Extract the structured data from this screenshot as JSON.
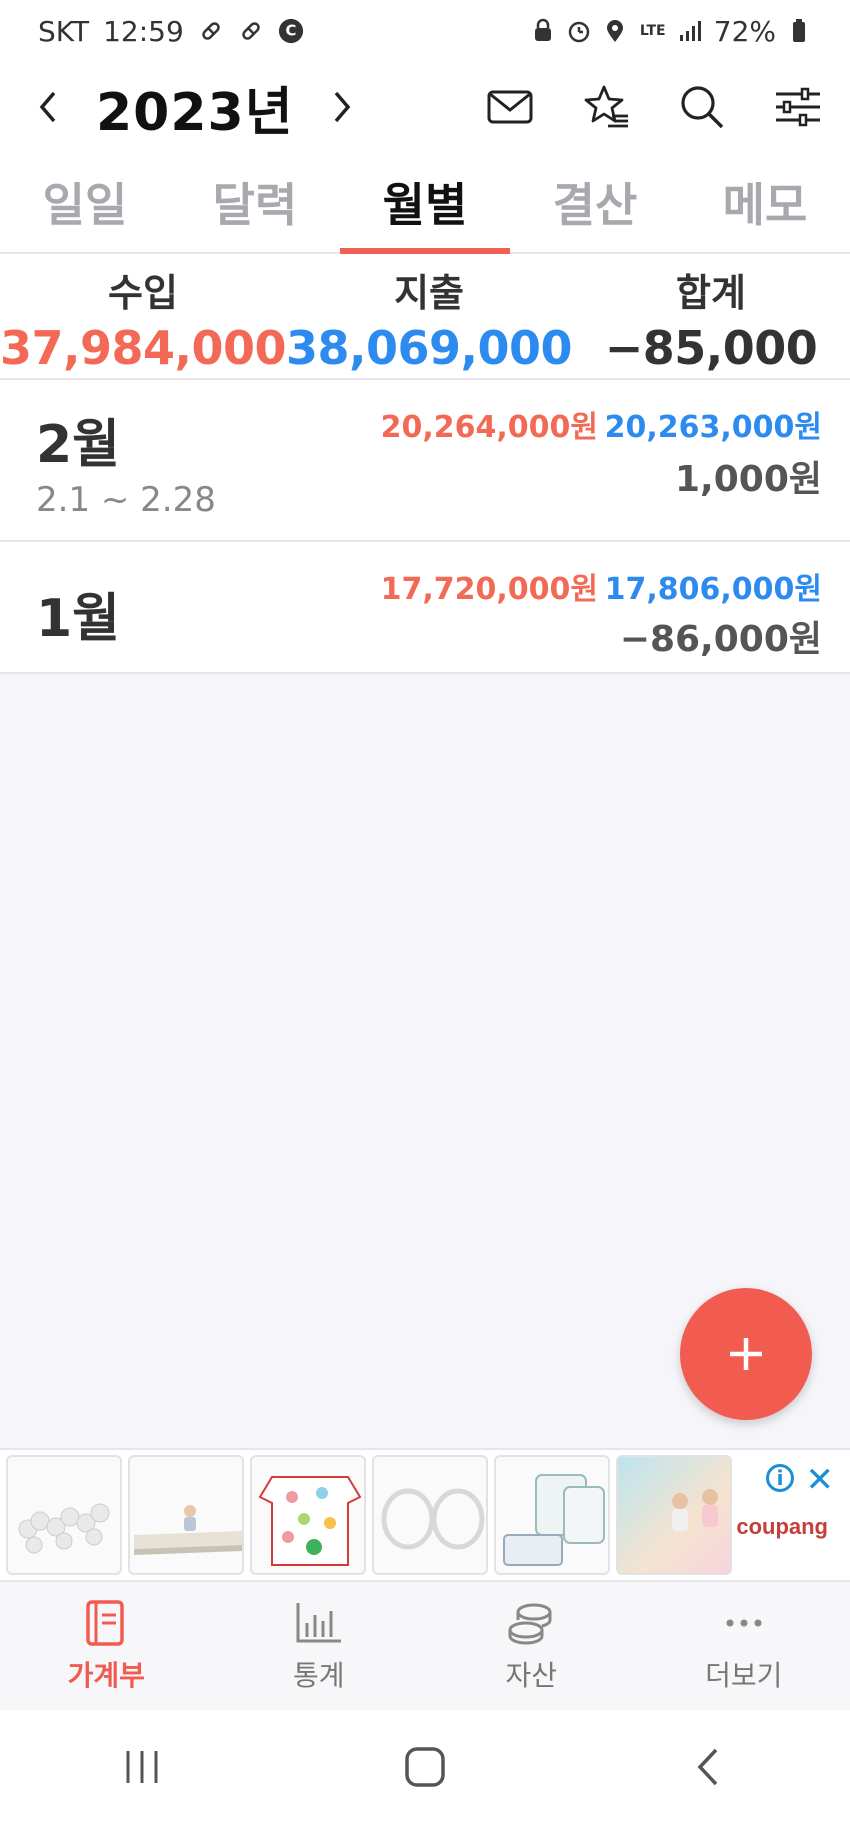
{
  "status_bar": {
    "carrier": "SKT",
    "time": "12:59",
    "battery": "72%",
    "network": "LTE"
  },
  "header": {
    "year": "2023년"
  },
  "tabs": [
    {
      "label": "일일"
    },
    {
      "label": "달력"
    },
    {
      "label": "월별"
    },
    {
      "label": "결산"
    },
    {
      "label": "메모"
    }
  ],
  "summary": {
    "income_label": "수입",
    "income_value": "37,984,000",
    "expense_label": "지출",
    "expense_value": "38,069,000",
    "total_label": "합계",
    "total_value": "−85,000"
  },
  "months": [
    {
      "name": "2월",
      "range": "2.1 ~ 2.28",
      "income": "20,264,000원",
      "expense": "20,263,000원",
      "total": "1,000원"
    },
    {
      "name": "1월",
      "range": "",
      "income": "17,720,000원",
      "expense": "17,806,000원",
      "total": "−86,000원"
    }
  ],
  "ad": {
    "brand": "coupang"
  },
  "bottom_nav": [
    {
      "label": "가계부"
    },
    {
      "label": "통계"
    },
    {
      "label": "자산"
    },
    {
      "label": "더보기"
    }
  ],
  "colors": {
    "accent": "#f25c50",
    "income": "#f26a55",
    "expense": "#2d8bf0"
  }
}
